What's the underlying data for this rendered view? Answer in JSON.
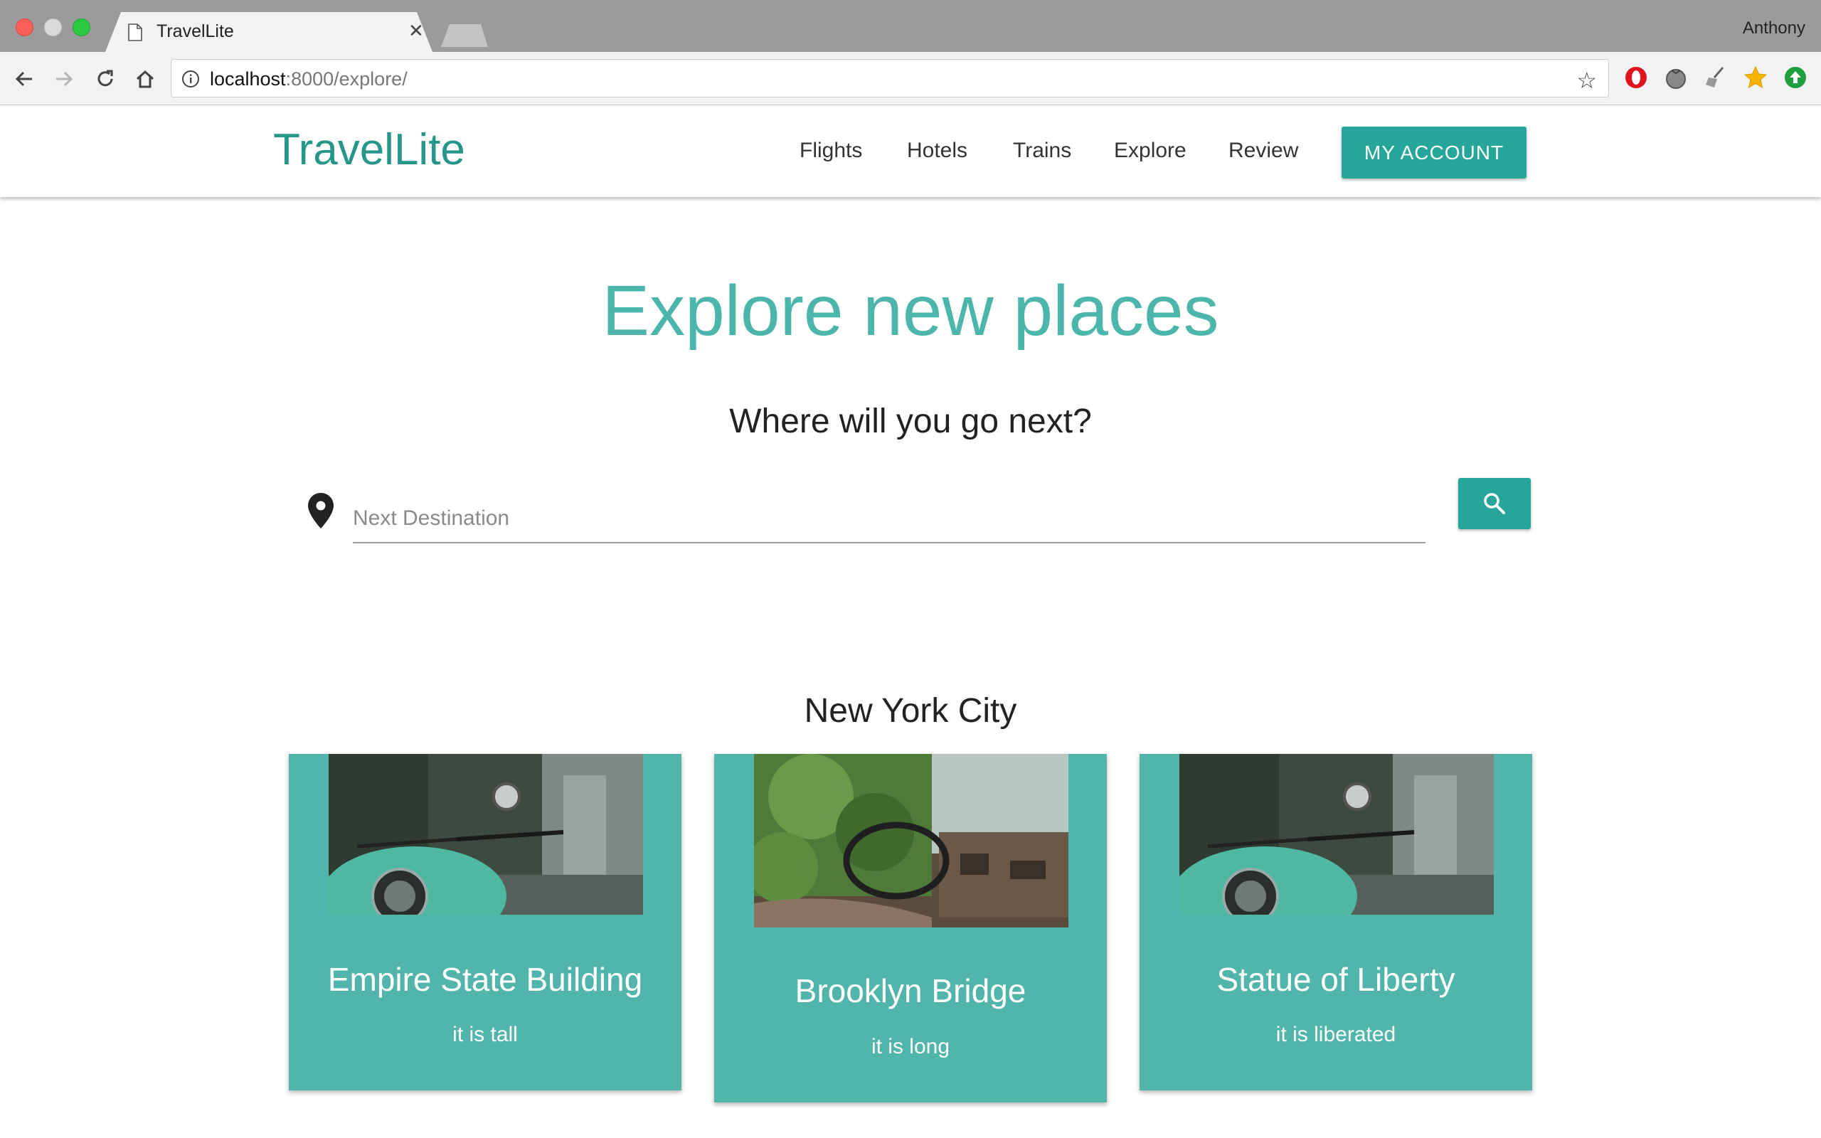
{
  "browser": {
    "tab_title": "TravelLite",
    "profile_name": "Anthony",
    "url_host": "localhost",
    "url_rest": ":8000/explore/"
  },
  "site": {
    "brand": "TravelLite",
    "nav": [
      "Flights",
      "Hotels",
      "Trains",
      "Explore",
      "Review"
    ],
    "account_button": "MY ACCOUNT",
    "accent_color": "#26a69a"
  },
  "hero": {
    "title": "Explore new places",
    "subtitle": "Where will you go next?"
  },
  "search": {
    "placeholder": "Next Destination",
    "value": ""
  },
  "section": {
    "title": "New York City",
    "cards": [
      {
        "title": "Empire State Building",
        "text": "it is tall",
        "image": "scooter-photo"
      },
      {
        "title": "Brooklyn Bridge",
        "text": "it is long",
        "image": "abandoned-car-photo"
      },
      {
        "title": "Statue of Liberty",
        "text": "it is liberated",
        "image": "scooter-photo"
      }
    ]
  }
}
